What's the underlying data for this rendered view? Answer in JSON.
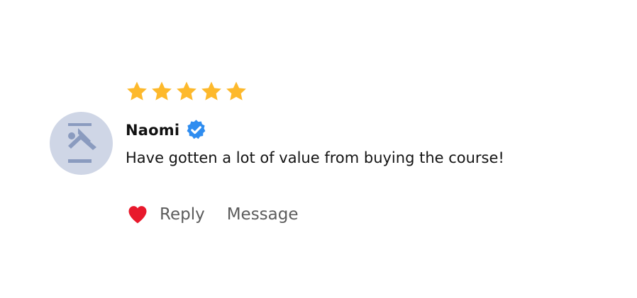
{
  "review": {
    "rating": 5,
    "rating_max": 5,
    "star_color": "#FDB92C",
    "author": {
      "name": "Naomi",
      "verified": true,
      "verified_icon": "verified-badge-icon",
      "verified_color": "#2F8DF0",
      "avatar_icon": "placeholder-avatar-icon"
    },
    "text": "Have gotten a lot of value from buying the course!",
    "actions": {
      "like_icon": "heart-icon",
      "like_color": "#E8192C",
      "reply_label": "Reply",
      "message_label": "Message"
    }
  }
}
